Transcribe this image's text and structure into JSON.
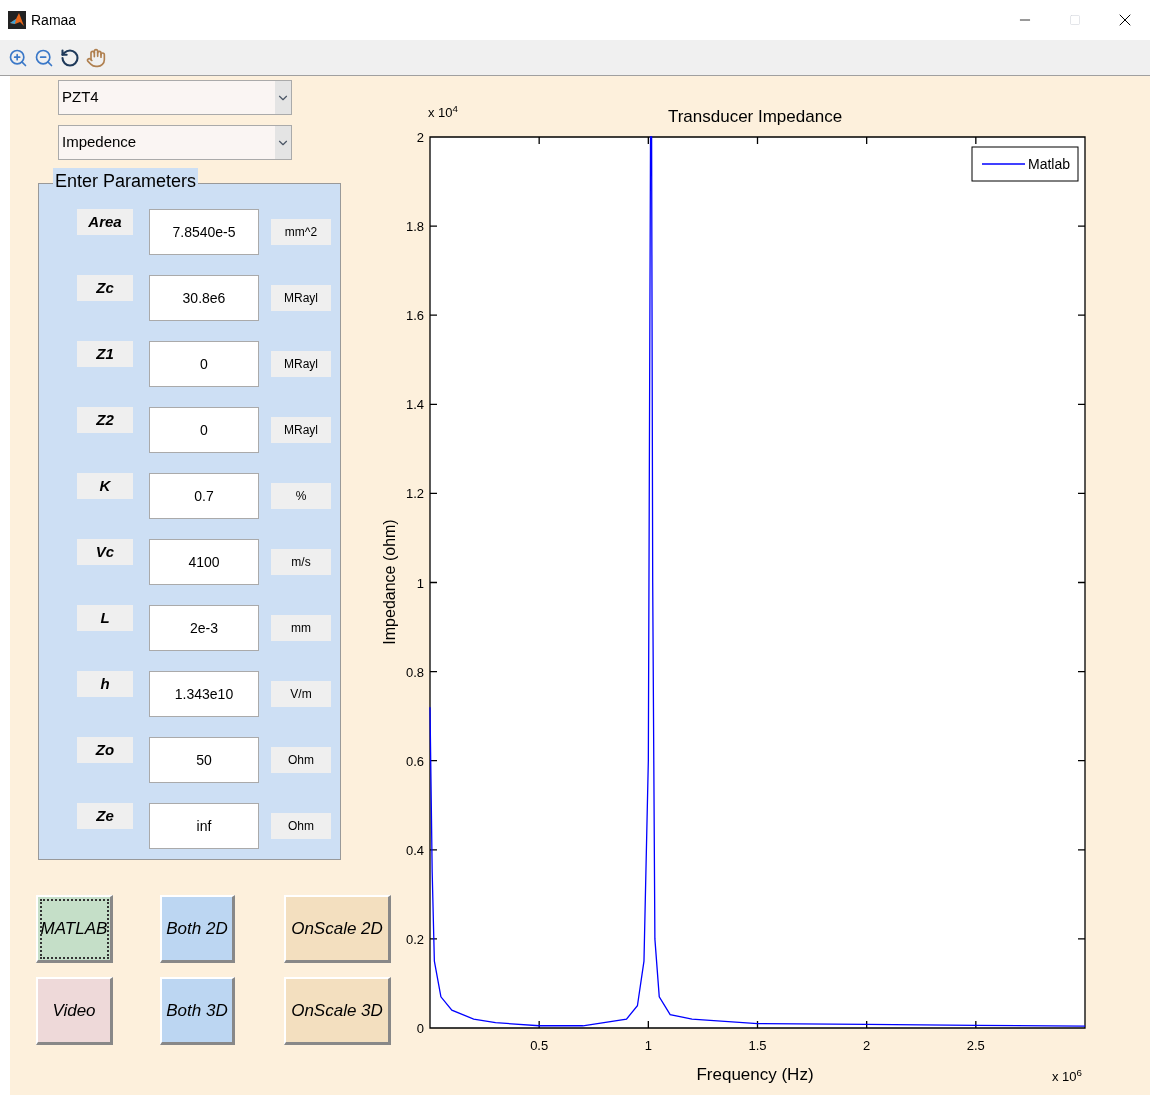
{
  "window": {
    "title": "Ramaa"
  },
  "dropdowns": [
    {
      "value": "PZT4"
    },
    {
      "value": "Impedence"
    }
  ],
  "parameters": {
    "title": "Enter Parameters",
    "rows": [
      {
        "label": "Area",
        "value": "7.8540e-5",
        "unit": "mm^2"
      },
      {
        "label": "Zc",
        "value": "30.8e6",
        "unit": "MRayl"
      },
      {
        "label": "Z1",
        "value": "0",
        "unit": "MRayl"
      },
      {
        "label": "Z2",
        "value": "0",
        "unit": "MRayl"
      },
      {
        "label": "K",
        "value": "0.7",
        "unit": "%"
      },
      {
        "label": "Vc",
        "value": "4100",
        "unit": "m/s"
      },
      {
        "label": "L",
        "value": "2e-3",
        "unit": "mm"
      },
      {
        "label": "h",
        "value": "1.343e10",
        "unit": "V/m"
      },
      {
        "label": "Zo",
        "value": "50",
        "unit": "Ohm"
      },
      {
        "label": "Ze",
        "value": "inf",
        "unit": "Ohm"
      }
    ]
  },
  "buttons": [
    {
      "label": "MATLAB",
      "color": "#c5dfc8",
      "focused": true
    },
    {
      "label": "Both 2D",
      "color": "#bcd6f2",
      "focused": false
    },
    {
      "label": "OnScale 2D",
      "color": "#f3dfbf",
      "focused": false
    },
    {
      "label": "Video",
      "color": "#eed9d9",
      "focused": false
    },
    {
      "label": "Both 3D",
      "color": "#bcd6f2",
      "focused": false
    },
    {
      "label": "OnScale 3D",
      "color": "#f3dfbf",
      "focused": false
    }
  ],
  "plot": {
    "y_multiplier": "x 10$^{4}$",
    "x_multiplier": "x 10$^{6}$",
    "chart_data": {
      "type": "line",
      "title": "Transducer Impedance",
      "xlabel": "Frequency (Hz)",
      "ylabel": "Impedance (ohm)",
      "x": [
        0,
        0.01,
        0.02,
        0.05,
        0.1,
        0.2,
        0.3,
        0.5,
        0.7,
        0.9,
        0.95,
        0.98,
        1.0,
        1.01,
        1.015,
        1.02,
        1.03,
        1.05,
        1.1,
        1.2,
        1.5,
        2,
        2.5,
        3
      ],
      "series": [
        {
          "name": "Matlab",
          "color": "#0000ff",
          "values": [
            0.72,
            0.35,
            0.15,
            0.07,
            0.04,
            0.02,
            0.012,
            0.005,
            0.005,
            0.02,
            0.05,
            0.15,
            0.6,
            2.0,
            2.0,
            1.0,
            0.2,
            0.07,
            0.03,
            0.02,
            0.01,
            0.008,
            0.006,
            0.004
          ]
        }
      ],
      "xlim": [
        0,
        3
      ],
      "ylim": [
        0,
        2
      ],
      "xticks": [
        {
          "value": 0.5,
          "label": "0.5"
        },
        {
          "value": 1,
          "label": "1"
        },
        {
          "value": 1.5,
          "label": "1.5"
        },
        {
          "value": 2,
          "label": "2"
        },
        {
          "value": 2.5,
          "label": "2.5"
        }
      ],
      "yticks": [
        {
          "value": 0,
          "label": "0"
        },
        {
          "value": 0.2,
          "label": "0.2"
        },
        {
          "value": 0.4,
          "label": "0.4"
        },
        {
          "value": 0.6,
          "label": "0.6"
        },
        {
          "value": 0.8,
          "label": "0.8"
        },
        {
          "value": 1,
          "label": "1"
        },
        {
          "value": 1.2,
          "label": "1.2"
        },
        {
          "value": 1.4,
          "label": "1.4"
        },
        {
          "value": 1.6,
          "label": "1.6"
        },
        {
          "value": 1.8,
          "label": "1.8"
        },
        {
          "value": 2,
          "label": "2"
        }
      ]
    }
  }
}
